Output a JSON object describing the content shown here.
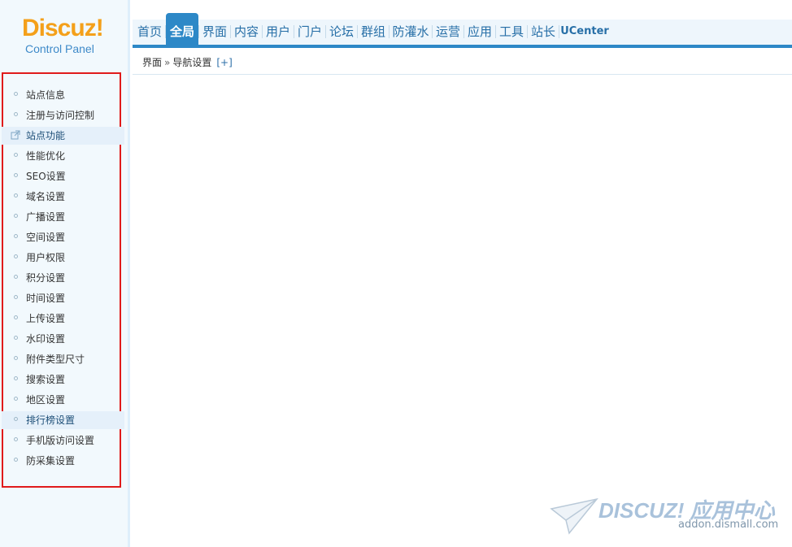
{
  "logo": {
    "name": "Discuz!",
    "subtitle": "Control Panel"
  },
  "nav": {
    "tabs": [
      {
        "label": "首页"
      },
      {
        "label": "全局"
      },
      {
        "label": "界面"
      },
      {
        "label": "内容"
      },
      {
        "label": "用户"
      },
      {
        "label": "门户"
      },
      {
        "label": "论坛"
      },
      {
        "label": "群组"
      },
      {
        "label": "防灌水"
      },
      {
        "label": "运营"
      },
      {
        "label": "应用"
      },
      {
        "label": "工具"
      },
      {
        "label": "站长"
      },
      {
        "label": "UCenter"
      }
    ],
    "active": "全局"
  },
  "breadcrumb": {
    "parent": "界面",
    "separator": "»",
    "current": "导航设置",
    "add": "[+]"
  },
  "sidebar": {
    "items": [
      {
        "label": "站点信息"
      },
      {
        "label": "注册与访问控制"
      },
      {
        "label": "站点功能",
        "icon": "external-link-icon"
      },
      {
        "label": "性能优化"
      },
      {
        "label": "SEO设置"
      },
      {
        "label": "域名设置"
      },
      {
        "label": "广播设置"
      },
      {
        "label": "空间设置"
      },
      {
        "label": "用户权限"
      },
      {
        "label": "积分设置"
      },
      {
        "label": "时间设置"
      },
      {
        "label": "上传设置"
      },
      {
        "label": "水印设置"
      },
      {
        "label": "附件类型尺寸"
      },
      {
        "label": "搜索设置"
      },
      {
        "label": "地区设置"
      },
      {
        "label": "排行榜设置"
      },
      {
        "label": "手机版访问设置"
      },
      {
        "label": "防采集设置"
      }
    ],
    "highlighted": [
      "站点功能",
      "排行榜设置"
    ]
  },
  "watermark": {
    "brand": "DISCUZ! 应用中心",
    "url": "addon.dismall.com"
  },
  "colors": {
    "accent": "#2d88c7",
    "logo": "#f4a01a",
    "highlight_border": "#e01b1b"
  }
}
